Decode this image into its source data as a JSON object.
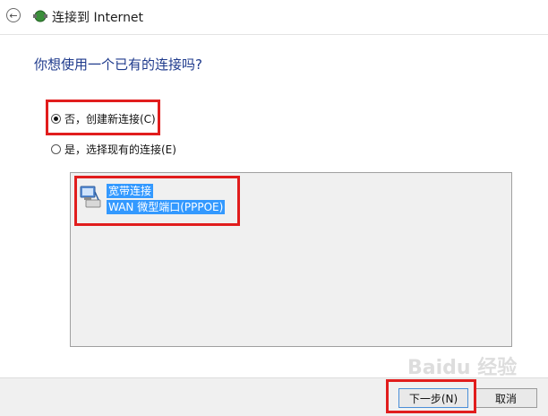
{
  "window": {
    "title": "连接到 Internet",
    "back_icon": "back-arrow-icon"
  },
  "heading": "你想使用一个已有的连接吗?",
  "options": [
    {
      "label": "否，创建新连接(C)",
      "checked": true
    },
    {
      "label": "是，选择现有的连接(E)",
      "checked": false
    }
  ],
  "connection": {
    "name": "宽带连接",
    "device": "WAN 微型端口(PPPOE)",
    "selected": true
  },
  "buttons": {
    "next": "下一步(N)",
    "cancel": "取消"
  },
  "watermark": "Baidu 经验",
  "colors": {
    "heading": "#1e3a8c",
    "selection": "#3399ff",
    "highlight_box": "#e11d1d"
  }
}
